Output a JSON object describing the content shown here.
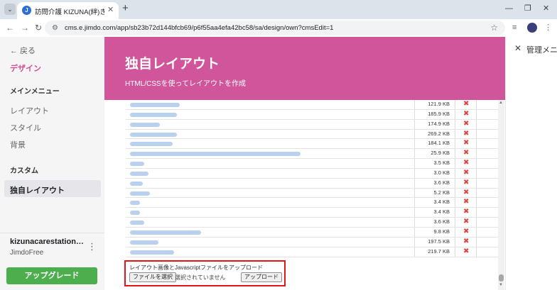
{
  "browser": {
    "tab_list_icon": "chevron-down-icon",
    "tab_title": "訪問介護 KIZUNA(絆)きずな) ケア",
    "favicon_letter": "J",
    "tab_close": "✕",
    "new_tab": "+",
    "url": "cms.e.jimdo.com/app/sb23b72d144bfcb69/p6f55aa4efa42bc58/sa/design/own?cmsEdit=1",
    "window_controls": {
      "minimize": "—",
      "maximize": "❐",
      "close": "✕"
    }
  },
  "sidebar": {
    "back_label": "←  戻る",
    "design_label": "デザイン",
    "main_menu_heading": "メインメニュー",
    "items": [
      "レイアウト",
      "スタイル",
      "背景"
    ],
    "custom_heading": "カスタム",
    "active_item": "独自レイアウト",
    "site_name": "kizunacarestation…",
    "site_plan": "JimdoFree",
    "more_icon": "⋮",
    "upgrade_label": "アップグレード"
  },
  "main": {
    "title": "独自レイアウト",
    "subtitle": "HTML/CSSを使ってレイアウトを作成",
    "files": [
      {
        "size": "121.9 KB"
      },
      {
        "size": "185.9 KB"
      },
      {
        "size": "174.9 KB"
      },
      {
        "size": "269.2 KB"
      },
      {
        "size": "184.1 KB"
      },
      {
        "size": "25.9 KB"
      },
      {
        "size": "3.5 KB"
      },
      {
        "size": "3.0 KB"
      },
      {
        "size": "3.6 KB"
      },
      {
        "size": "5.2 KB"
      },
      {
        "size": "3.4 KB"
      },
      {
        "size": "3.4 KB"
      },
      {
        "size": "3.6 KB"
      },
      {
        "size": "9.8 KB"
      },
      {
        "size": "197.5 KB"
      },
      {
        "size": "219.7 KB"
      }
    ],
    "delete_icon": "✖",
    "upload": {
      "label": "レイアウト画像とJavascriptファイルをアップロード",
      "choose_button": "ファイルを選択",
      "no_file_text": "選択されていません",
      "upload_button": "アップロード"
    }
  },
  "right_panel": {
    "close_icon": "✕",
    "title": "管理メニュー"
  },
  "colors": {
    "brand_pink": "#d1559a",
    "upgrade_green": "#4cae4c",
    "highlight_red": "#e3141a",
    "delete_red": "#e0443a"
  }
}
